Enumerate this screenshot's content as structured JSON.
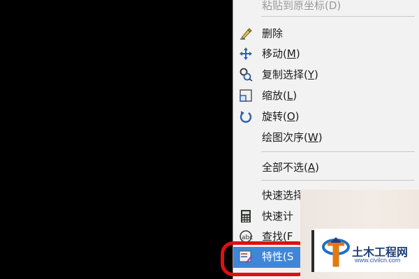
{
  "menu": {
    "items": [
      {
        "label": "粘贴到原坐标(D)",
        "icon": "none",
        "disabled": true
      },
      {
        "label": "删除",
        "icon": "eraser-icon"
      },
      {
        "label": "移动(M)",
        "icon": "move-icon"
      },
      {
        "label": "复制选择(Y)",
        "icon": "copy-select-icon"
      },
      {
        "label": "缩放(L)",
        "icon": "scale-icon"
      },
      {
        "label": "旋转(O)",
        "icon": "rotate-icon"
      },
      {
        "label": "绘图次序(W)",
        "icon": "none"
      },
      {
        "label": "全部不选(A)",
        "icon": "none"
      },
      {
        "label": "快速选择(Q)",
        "icon": "none"
      },
      {
        "label": "快速计",
        "icon": "calculator-icon"
      },
      {
        "label": "查找(F",
        "icon": "find-icon"
      },
      {
        "label": "特性(S",
        "icon": "properties-icon",
        "highlighted": true
      }
    ]
  },
  "watermark": {
    "title": "土木工程网",
    "url": "www.civilcn.com"
  },
  "colors": {
    "background": "#000000",
    "menu_bg": "#f2f2f2",
    "highlight": "#3f86d8",
    "annotation_ring": "#e01010",
    "watermark_text": "#1e3f7a"
  }
}
